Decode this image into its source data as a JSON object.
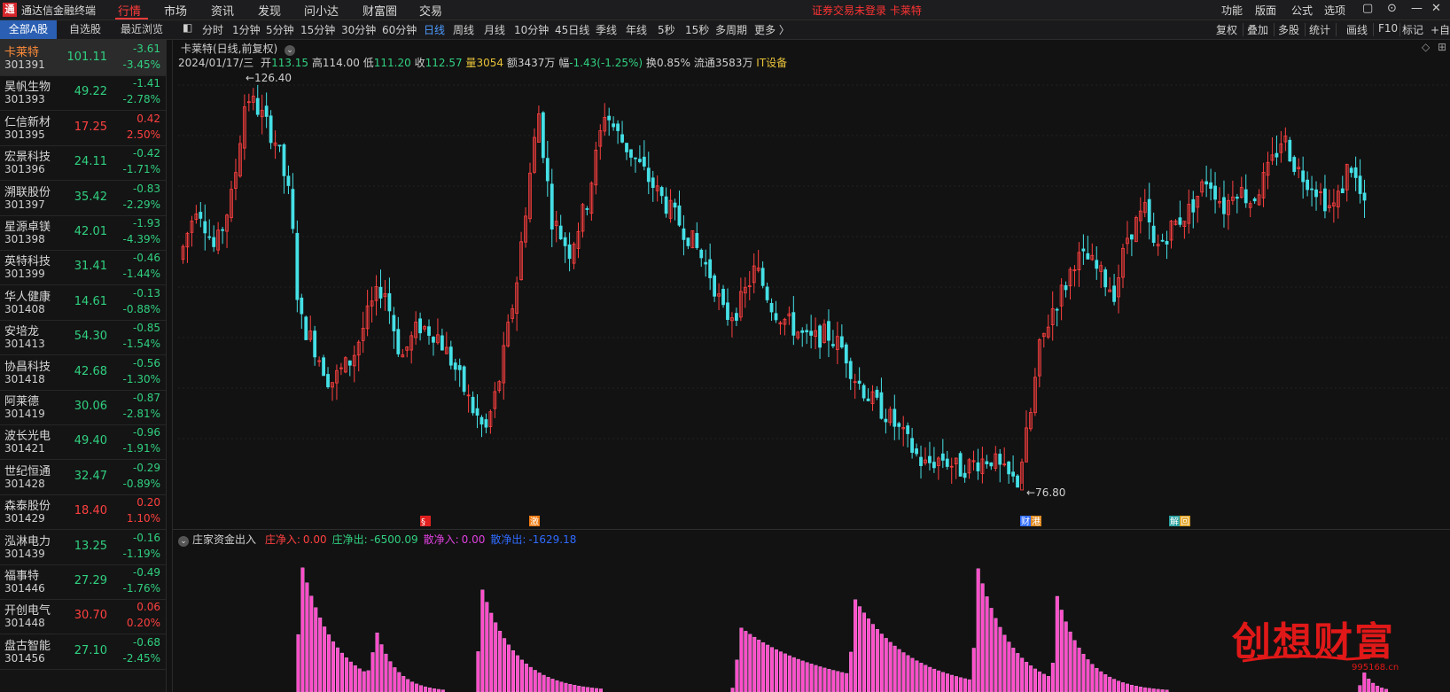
{
  "app": {
    "name": "通达信金融终端",
    "logo": "通"
  },
  "menu": [
    "行情",
    "市场",
    "资讯",
    "发现",
    "问小达",
    "财富圈",
    "交易"
  ],
  "notice": "证券交易未登录  卡莱特",
  "right_menu": [
    "功能",
    "版面",
    "公式",
    "选项"
  ],
  "list_tabs": [
    "全部A股",
    "自选股",
    "最近浏览"
  ],
  "periods": [
    "分时",
    "1分钟",
    "5分钟",
    "15分钟",
    "30分钟",
    "60分钟",
    "日线",
    "周线",
    "月线",
    "10分钟",
    "45日线",
    "季线",
    "年线",
    "5秒",
    "15秒",
    "多周期",
    "更多 〉"
  ],
  "right_tools": [
    "复权",
    "叠加",
    "多股",
    "统计",
    "画线",
    "F10",
    "标记",
    "+自选"
  ],
  "stocks": [
    {
      "name": "卡莱特",
      "code": "301391",
      "price": "101.11",
      "chg": "-3.61",
      "pct": "-3.45%",
      "dir": "dn"
    },
    {
      "name": "昊帆生物",
      "code": "301393",
      "price": "49.22",
      "chg": "-1.41",
      "pct": "-2.78%",
      "dir": "dn"
    },
    {
      "name": "仁信新材",
      "code": "301395",
      "price": "17.25",
      "chg": "0.42",
      "pct": "2.50%",
      "dir": "up"
    },
    {
      "name": "宏景科技",
      "code": "301396",
      "price": "24.11",
      "chg": "-0.42",
      "pct": "-1.71%",
      "dir": "dn"
    },
    {
      "name": "溯联股份",
      "code": "301397",
      "price": "35.42",
      "chg": "-0.83",
      "pct": "-2.29%",
      "dir": "dn"
    },
    {
      "name": "星源卓镁",
      "code": "301398",
      "price": "42.01",
      "chg": "-1.93",
      "pct": "-4.39%",
      "dir": "dn"
    },
    {
      "name": "英特科技",
      "code": "301399",
      "price": "31.41",
      "chg": "-0.46",
      "pct": "-1.44%",
      "dir": "dn"
    },
    {
      "name": "华人健康",
      "code": "301408",
      "price": "14.61",
      "chg": "-0.13",
      "pct": "-0.88%",
      "dir": "dn"
    },
    {
      "name": "安培龙",
      "code": "301413",
      "price": "54.30",
      "chg": "-0.85",
      "pct": "-1.54%",
      "dir": "dn"
    },
    {
      "name": "协昌科技",
      "code": "301418",
      "price": "42.68",
      "chg": "-0.56",
      "pct": "-1.30%",
      "dir": "dn"
    },
    {
      "name": "阿莱德",
      "code": "301419",
      "price": "30.06",
      "chg": "-0.87",
      "pct": "-2.81%",
      "dir": "dn"
    },
    {
      "name": "波长光电",
      "code": "301421",
      "price": "49.40",
      "chg": "-0.96",
      "pct": "-1.91%",
      "dir": "dn"
    },
    {
      "name": "世纪恒通",
      "code": "301428",
      "price": "32.47",
      "chg": "-0.29",
      "pct": "-0.89%",
      "dir": "dn"
    },
    {
      "name": "森泰股份",
      "code": "301429",
      "price": "18.40",
      "chg": "0.20",
      "pct": "1.10%",
      "dir": "up"
    },
    {
      "name": "泓淋电力",
      "code": "301439",
      "price": "13.25",
      "chg": "-0.16",
      "pct": "-1.19%",
      "dir": "dn"
    },
    {
      "name": "福事特",
      "code": "301446",
      "price": "27.29",
      "chg": "-0.49",
      "pct": "-1.76%",
      "dir": "dn"
    },
    {
      "name": "开创电气",
      "code": "301448",
      "price": "30.70",
      "chg": "0.06",
      "pct": "0.20%",
      "dir": "up"
    },
    {
      "name": "盘古智能",
      "code": "301456",
      "price": "27.10",
      "chg": "-0.68",
      "pct": "-2.45%",
      "dir": "dn"
    }
  ],
  "chart": {
    "title": "卡莱特(日线,前复权)",
    "date": "2024/01/17/三",
    "open_label": "开",
    "open": "113.15",
    "high_label": "高",
    "high": "114.00",
    "low_label": "低",
    "low": "111.20",
    "close_label": "收",
    "close": "112.57",
    "vol_label": "量",
    "vol": "3054",
    "amt_label": "额",
    "amt": "3437万",
    "range_label": "幅",
    "range": "-1.43(-1.25%)",
    "turn_label": "换",
    "turn": "0.85%",
    "float_label": "流通",
    "float": "3583万",
    "sector": "IT设备",
    "max_label": "126.40",
    "min_label": "76.80",
    "markers": [
      "§",
      "激",
      "财",
      "港",
      "解",
      "回"
    ]
  },
  "sub": {
    "name": "庄家资金出入",
    "items": [
      {
        "label": "庄净入:",
        "value": "0.00",
        "color": "#ff4040"
      },
      {
        "label": "庄净出:",
        "value": "-6500.09",
        "color": "#30d080"
      },
      {
        "label": "散净入:",
        "value": "0.00",
        "color": "#e040e0"
      },
      {
        "label": "散净出:",
        "value": "-1629.18",
        "color": "#2f6bff"
      }
    ]
  },
  "watermark": {
    "text": "创想财富",
    "url": "995168.cn"
  },
  "colors": {
    "up": "#ff4040",
    "down": "#45e0e6",
    "bar": "#ff4ecb",
    "accent": "#2a5fb3"
  },
  "chart_data": {
    "type": "candlestick",
    "title": "卡莱特(日线,前复权)",
    "ylim": [
      76.8,
      126.4
    ],
    "annotations": {
      "high": 126.4,
      "low": 76.8
    },
    "candles_count": 270,
    "sub_type": "bar",
    "sub_series": [
      {
        "name": "庄净入",
        "value": 0.0
      },
      {
        "name": "庄净出",
        "value": -6500.09
      },
      {
        "name": "散净入",
        "value": 0.0
      },
      {
        "name": "散净出",
        "value": -1629.18
      }
    ]
  }
}
